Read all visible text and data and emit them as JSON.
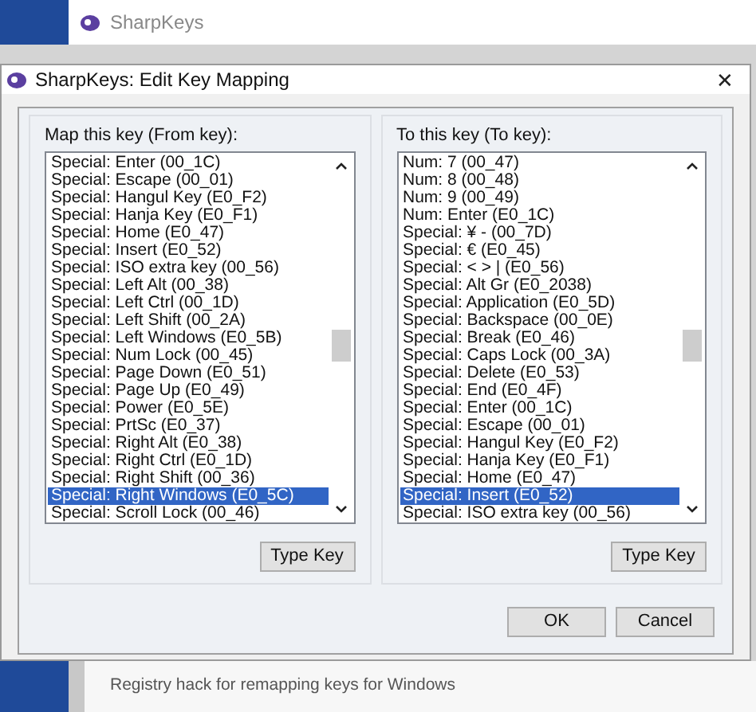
{
  "background_window": {
    "title": "SharpKeys",
    "status_text": "Registry hack for remapping keys for Windows"
  },
  "dialog": {
    "title": "SharpKeys: Edit Key Mapping",
    "close": "✕",
    "panels": [
      {
        "label": "Map this key (From key):",
        "button": "Type Key",
        "items": [
          {
            "text": "Special: Enter (00_1C)",
            "selected": false
          },
          {
            "text": "Special: Escape (00_01)",
            "selected": false
          },
          {
            "text": "Special: Hangul Key (E0_F2)",
            "selected": false
          },
          {
            "text": "Special: Hanja Key (E0_F1)",
            "selected": false
          },
          {
            "text": "Special: Home (E0_47)",
            "selected": false
          },
          {
            "text": "Special: Insert (E0_52)",
            "selected": false
          },
          {
            "text": "Special: ISO extra key (00_56)",
            "selected": false
          },
          {
            "text": "Special: Left Alt (00_38)",
            "selected": false
          },
          {
            "text": "Special: Left Ctrl (00_1D)",
            "selected": false
          },
          {
            "text": "Special: Left Shift (00_2A)",
            "selected": false
          },
          {
            "text": "Special: Left Windows (E0_5B)",
            "selected": false
          },
          {
            "text": "Special: Num Lock (00_45)",
            "selected": false
          },
          {
            "text": "Special: Page Down (E0_51)",
            "selected": false
          },
          {
            "text": "Special: Page Up (E0_49)",
            "selected": false
          },
          {
            "text": "Special: Power (E0_5E)",
            "selected": false
          },
          {
            "text": "Special: PrtSc (E0_37)",
            "selected": false
          },
          {
            "text": "Special: Right Alt (E0_38)",
            "selected": false
          },
          {
            "text": "Special: Right Ctrl (E0_1D)",
            "selected": false
          },
          {
            "text": "Special: Right Shift (00_36)",
            "selected": false
          },
          {
            "text": "Special: Right Windows (E0_5C)",
            "selected": true
          },
          {
            "text": "Special: Scroll Lock (00_46)",
            "selected": false
          }
        ]
      },
      {
        "label": "To this key (To key):",
        "button": "Type Key",
        "items": [
          {
            "text": "Num: 7 (00_47)",
            "selected": false
          },
          {
            "text": "Num: 8 (00_48)",
            "selected": false
          },
          {
            "text": "Num: 9 (00_49)",
            "selected": false
          },
          {
            "text": "Num: Enter (E0_1C)",
            "selected": false
          },
          {
            "text": "Special: ¥ - (00_7D)",
            "selected": false
          },
          {
            "text": "Special: € (E0_45)",
            "selected": false
          },
          {
            "text": "Special: < > | (E0_56)",
            "selected": false
          },
          {
            "text": "Special: Alt Gr (E0_2038)",
            "selected": false
          },
          {
            "text": "Special: Application (E0_5D)",
            "selected": false
          },
          {
            "text": "Special: Backspace (00_0E)",
            "selected": false
          },
          {
            "text": "Special: Break (E0_46)",
            "selected": false
          },
          {
            "text": "Special: Caps Lock (00_3A)",
            "selected": false
          },
          {
            "text": "Special: Delete (E0_53)",
            "selected": false
          },
          {
            "text": "Special: End (E0_4F)",
            "selected": false
          },
          {
            "text": "Special: Enter (00_1C)",
            "selected": false
          },
          {
            "text": "Special: Escape (00_01)",
            "selected": false
          },
          {
            "text": "Special: Hangul Key (E0_F2)",
            "selected": false
          },
          {
            "text": "Special: Hanja Key (E0_F1)",
            "selected": false
          },
          {
            "text": "Special: Home (E0_47)",
            "selected": false
          },
          {
            "text": "Special: Insert (E0_52)",
            "selected": true
          },
          {
            "text": "Special: ISO extra key (00_56)",
            "selected": false
          }
        ]
      }
    ],
    "buttons": [
      "OK",
      "Cancel"
    ]
  }
}
